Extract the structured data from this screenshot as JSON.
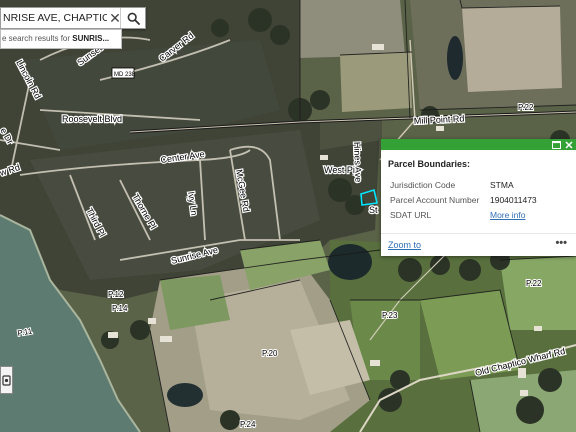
{
  "search": {
    "value": "NRISE AVE, CHAPTICC",
    "suggestion_prefix": "e search results for ",
    "suggestion_bold": "SUNRIS..."
  },
  "popup": {
    "title": "Parcel Boundaries:",
    "fields": [
      {
        "label": "Jurisdiction Code",
        "value": "STMA"
      },
      {
        "label": "Parcel Account Number",
        "value": "1904011473"
      },
      {
        "label": "SDAT URL",
        "value": "More info"
      }
    ],
    "zoom_link": "Zoom to",
    "more_icon": "•••",
    "header_color": "#33a135",
    "link_color": "#2f6fb5"
  },
  "map": {
    "roads": {
      "sunset_dr": "Sunset Dr",
      "lincoln_rd": "Lincoln Rd",
      "carver_rd": "Carver Rd",
      "roosevelt_blvd": "Roosevelt Blvd",
      "e_dr": "e Dr",
      "center_ave": "Center Ave",
      "mill_point_rd": "Mill Point Rd",
      "hines_ave": "Hines Ave",
      "west_pines": "West Pi",
      "st": "St",
      "mcgee_rd": "McGee Rd",
      "ivy_ln": "Ivy Ln",
      "thorne_pl": "Thorne Pl",
      "third_pl": "Third Pl",
      "sunrise_ave": "Sunrise Ave",
      "old_chaptico_wharf_rd": "Old Chaptico Wharf Rd",
      "w_rd": "w Rd"
    },
    "parcels": {
      "p1": "P.11",
      "p2": "P.22",
      "p3": "P.14",
      "p4": "P.12",
      "p5": "P.23",
      "p6": "P.20",
      "p7": "P.24",
      "p8": "P.22"
    },
    "route": "MD 238",
    "highlight_color": "#00e5ff"
  }
}
